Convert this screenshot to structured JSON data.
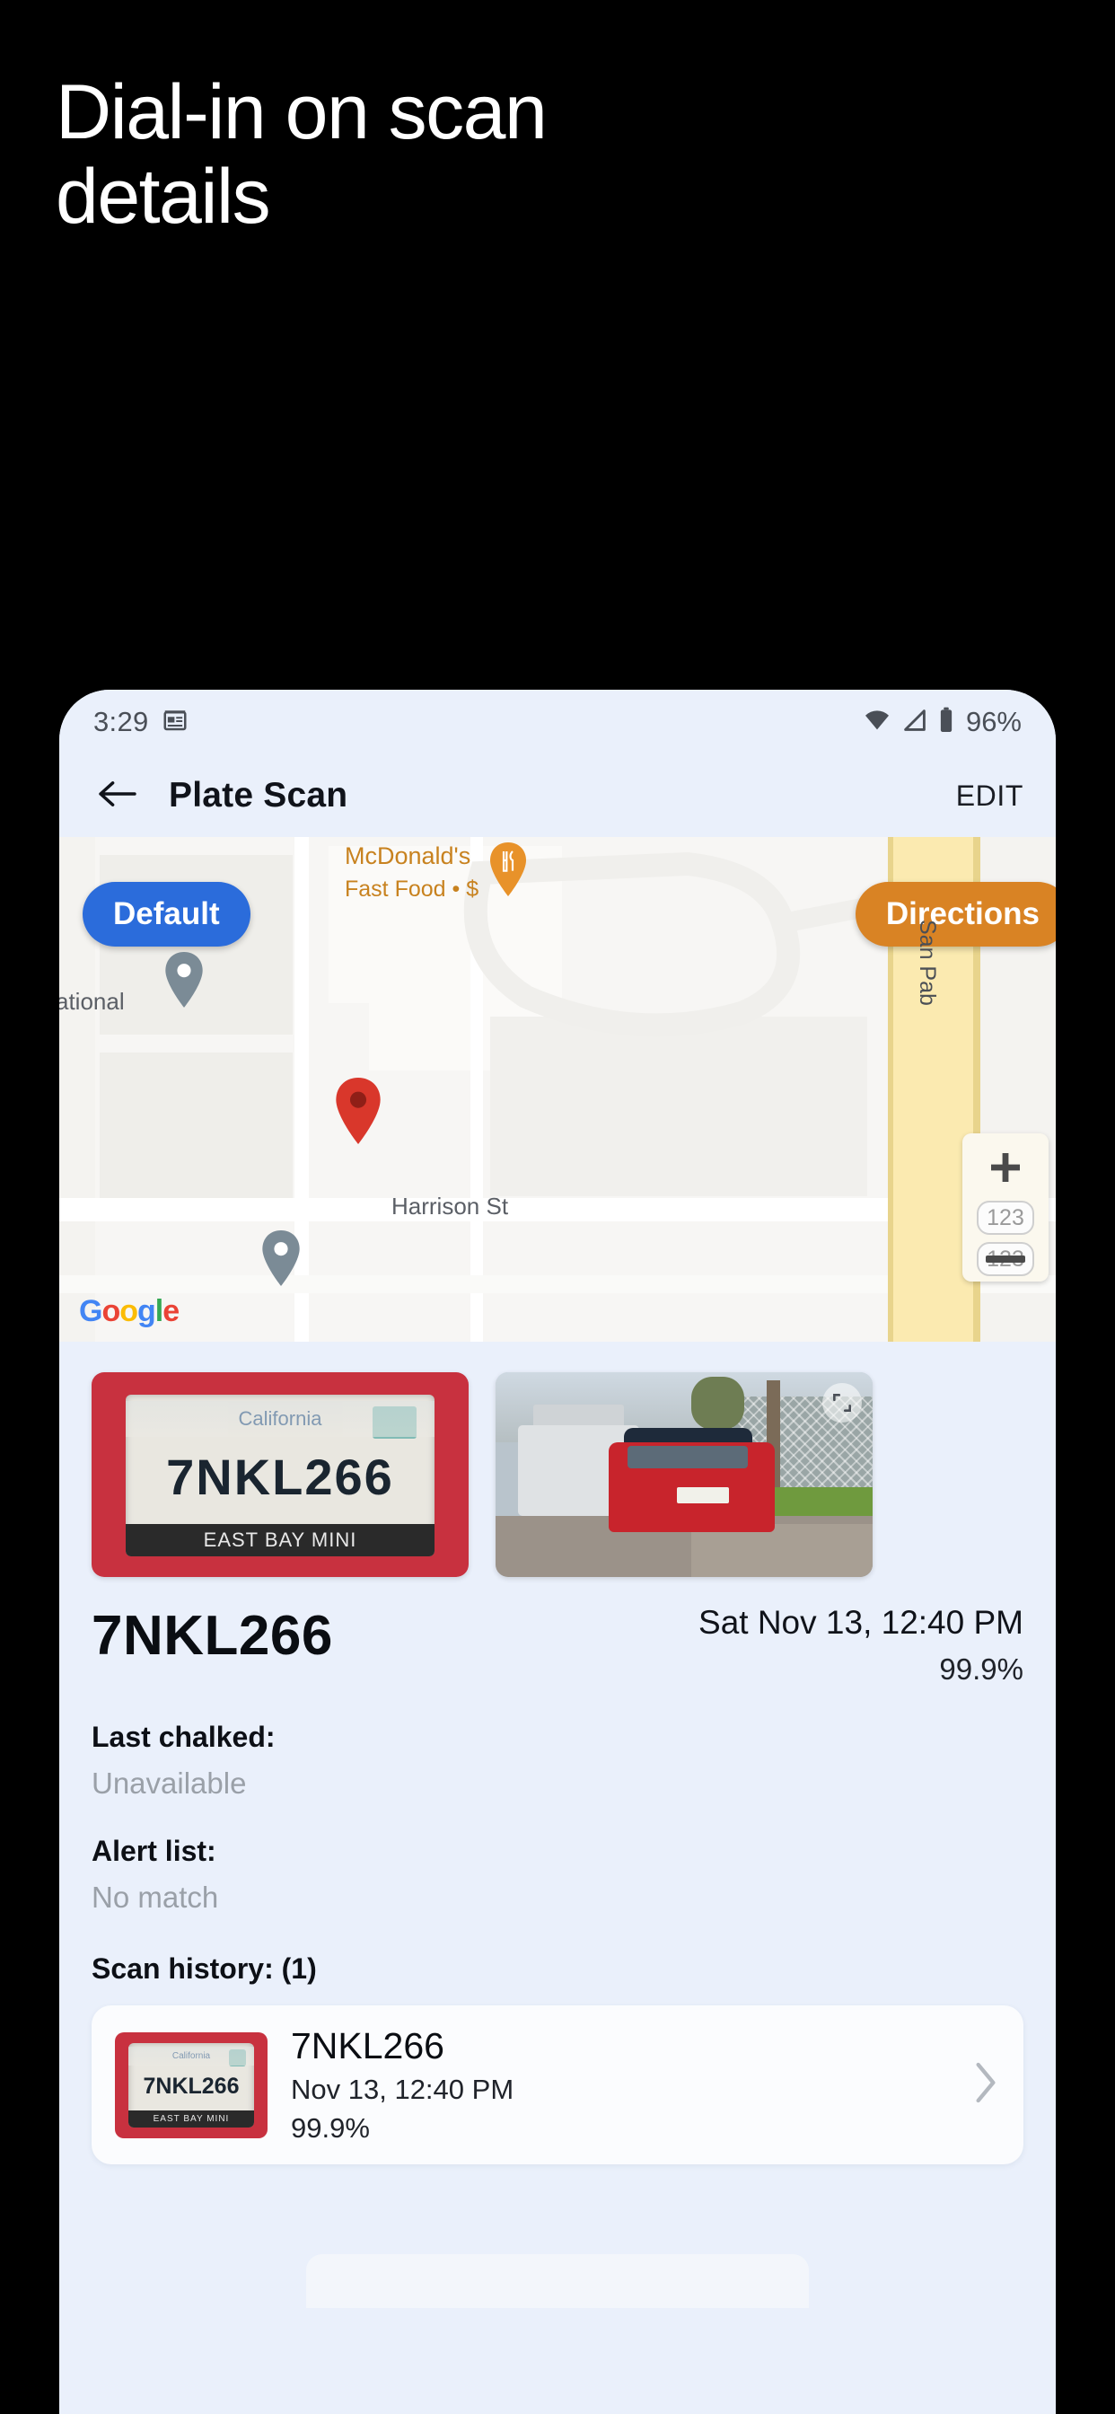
{
  "headline": {
    "line1": "Dial-in on scan",
    "line2": "details"
  },
  "phone": {
    "status_bar": {
      "time": "3:29",
      "news_icon": "news-calendar-icon",
      "wifi_icon": "wifi-icon",
      "signal_icon": "signal-triangle-icon",
      "battery_icon": "battery-icon",
      "battery_percent": "96%"
    },
    "app_bar": {
      "back_icon": "back-arrow-icon",
      "title": "Plate Scan",
      "edit_label": "EDIT"
    },
    "map": {
      "default_pill": "Default",
      "directions_pill": "Directions",
      "poi_name": "McDonald's",
      "poi_sub": "Fast Food • $",
      "poi_icon": "restaurant-pin-icon",
      "street_main": "Harrison St",
      "street_vertical": "San Pab",
      "place_partial": "ational",
      "zoom_in_icon": "plus-icon",
      "zoom_out_icon": "minus-icon",
      "shield_label": "123",
      "attribution": "Google",
      "marker_icon": "red-location-pin",
      "marker_color": "#d9372b",
      "default_pill_color": "#2b6cdb",
      "directions_pill_color": "#d98324"
    },
    "scan": {
      "plate_thumb_label": "license-plate-photo",
      "plate_text_on_image": "7NKL266",
      "plate_frame_text": "EAST BAY MINI",
      "plate_state_text": "California",
      "vehicle_thumb_label": "vehicle-photo",
      "expand_icon": "expand-icon",
      "plate_number": "7NKL266",
      "timestamp": "Sat Nov 13, 12:40 PM",
      "confidence": "99.9%"
    },
    "fields": [
      {
        "label": "Last chalked:",
        "value": "Unavailable"
      },
      {
        "label": "Alert list:",
        "value": "No match"
      }
    ],
    "history": {
      "section_label": "Scan history: (1)",
      "items": [
        {
          "plate": "7NKL266",
          "date": "Nov 13, 12:40 PM",
          "confidence": "99.9%",
          "chevron_icon": "chevron-right-icon"
        }
      ]
    }
  }
}
